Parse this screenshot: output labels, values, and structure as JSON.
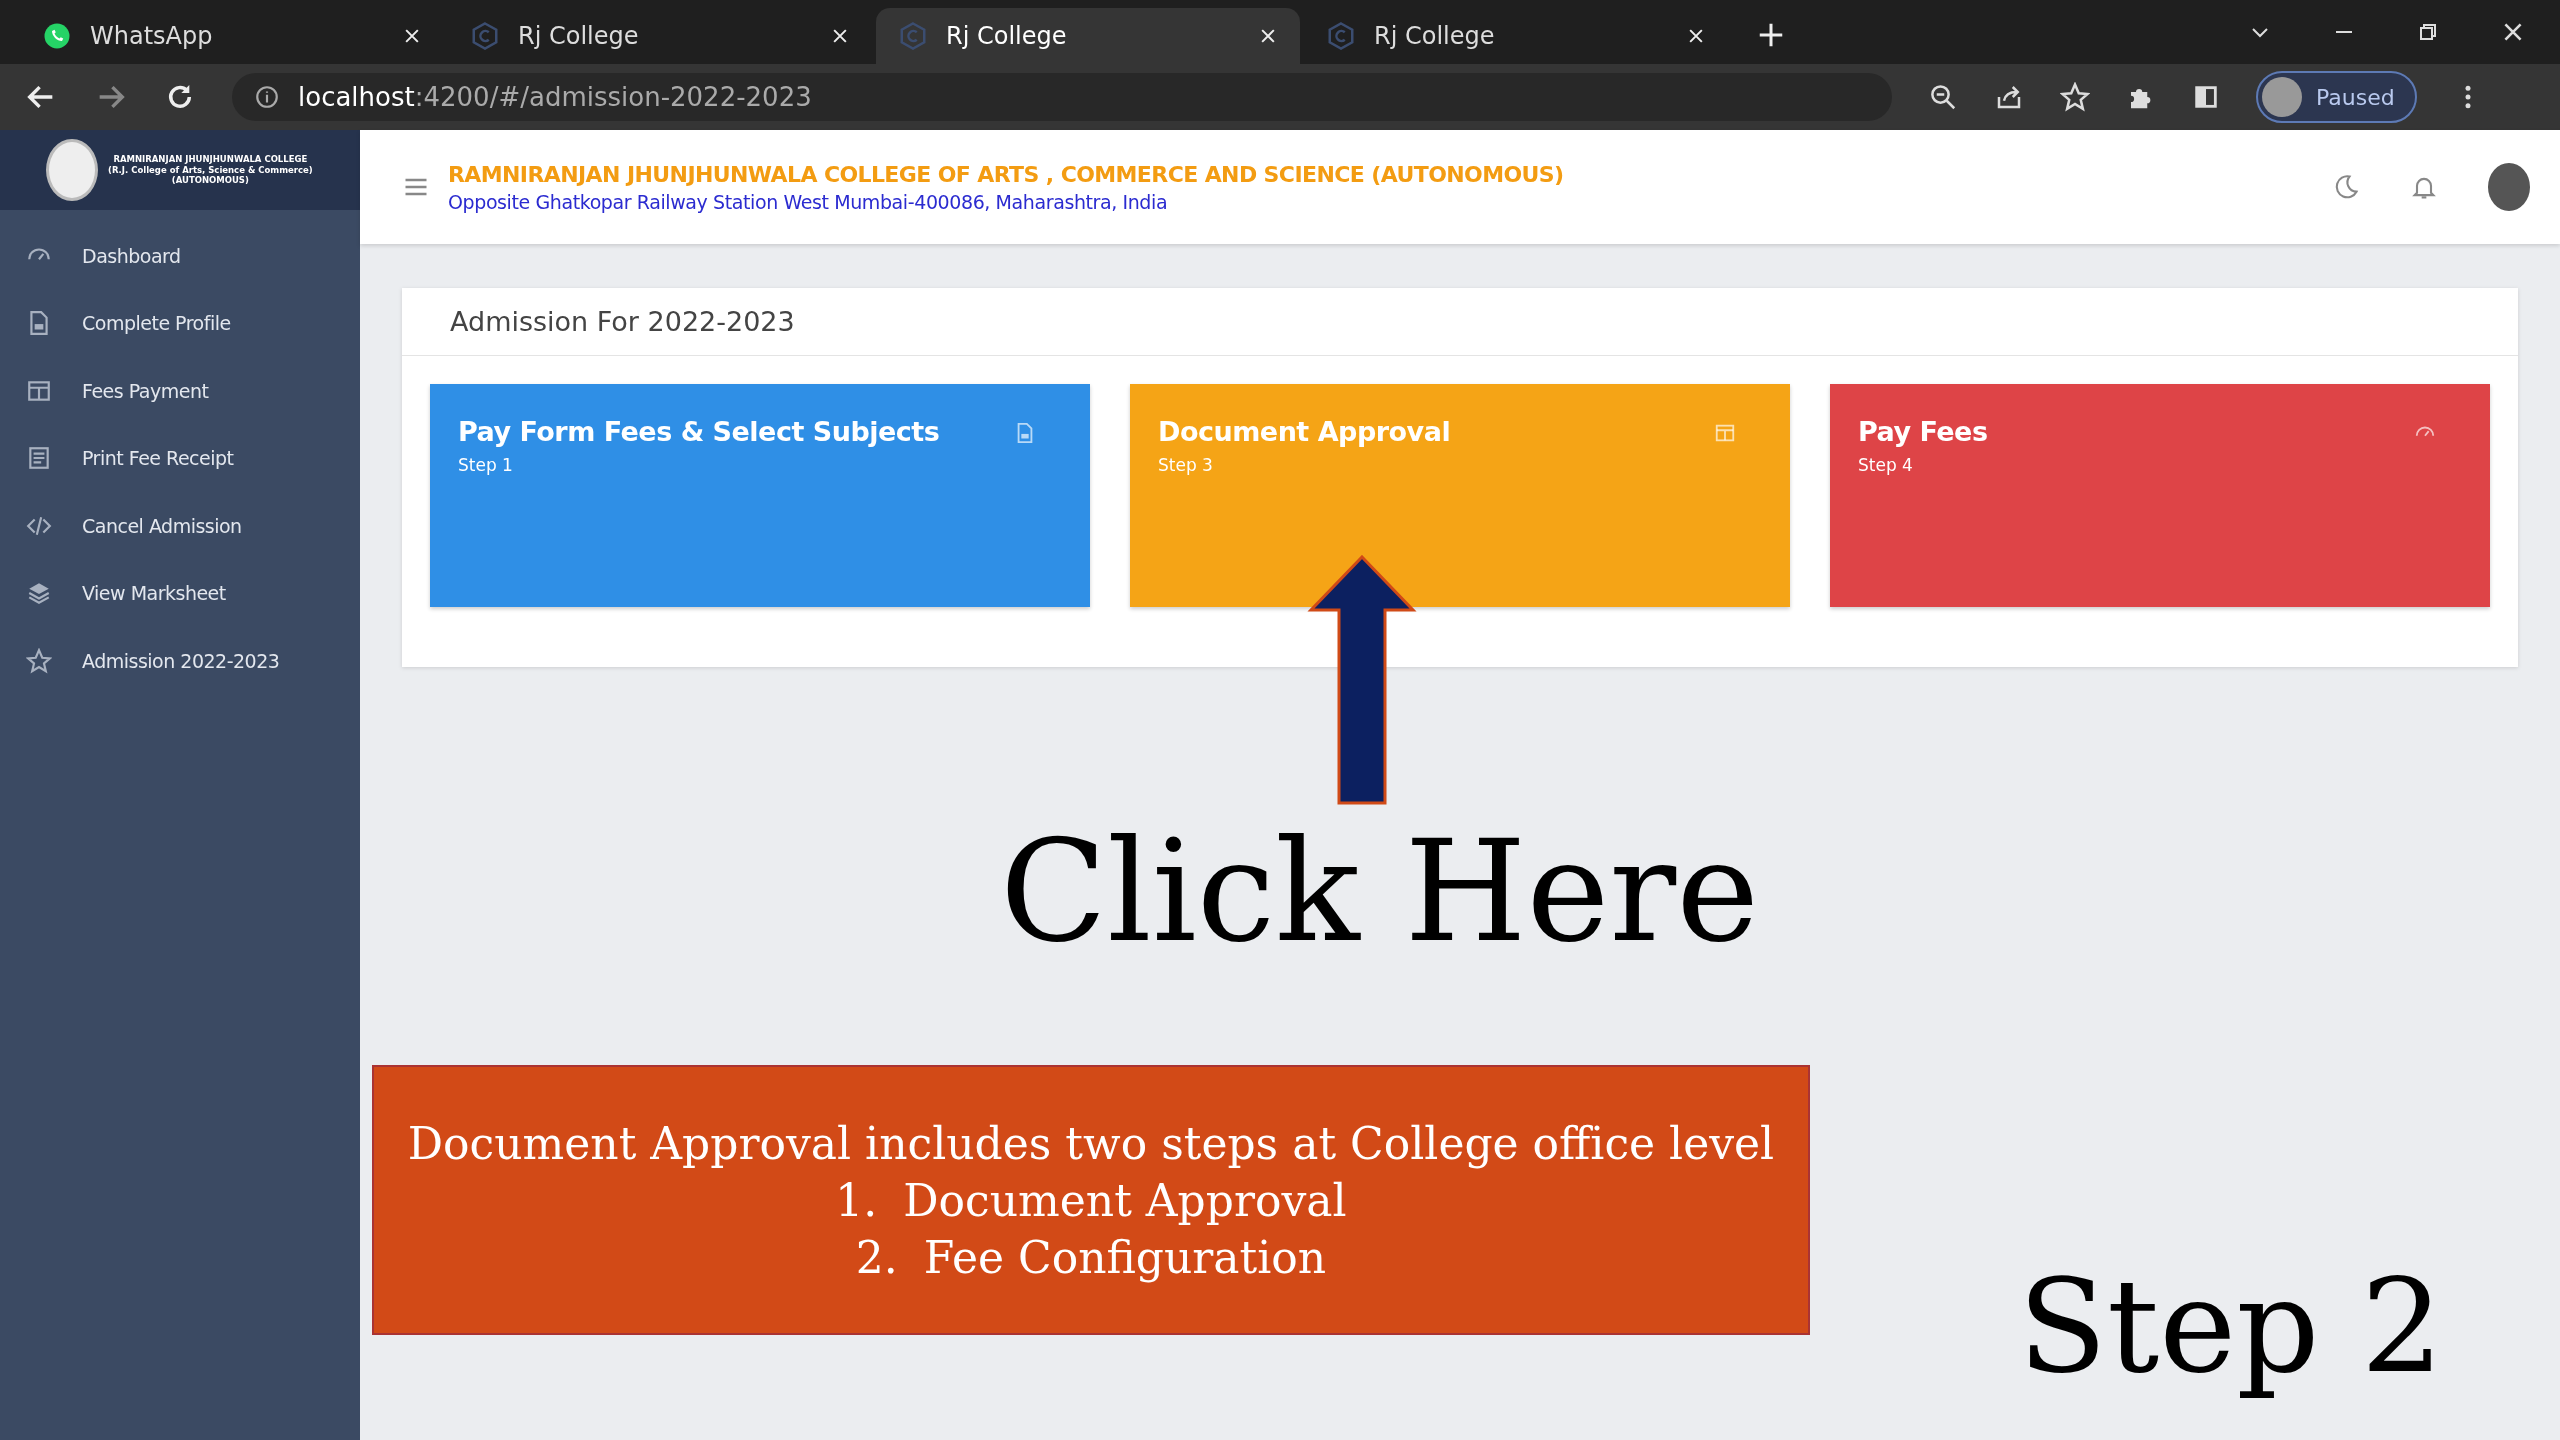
{
  "browser": {
    "tabs": [
      {
        "title": "WhatsApp",
        "kind": "whatsapp",
        "selected": false
      },
      {
        "title": "Rj College",
        "kind": "site",
        "selected": false
      },
      {
        "title": "Rj College",
        "kind": "site",
        "selected": true
      },
      {
        "title": "Rj College",
        "kind": "site",
        "selected": false
      }
    ],
    "address": {
      "host": "localhost",
      "rest": ":4200/#/admission-2022-2023"
    },
    "profile": "Paused"
  },
  "sidebar": {
    "logo_lines": [
      "RAMNIRANJAN JHUNJHUNWALA COLLEGE",
      "(R.J. College of Arts, Science & Commerce)",
      "(AUTONOMOUS)"
    ],
    "items": [
      {
        "label": "Dashboard",
        "kind": "gauge"
      },
      {
        "label": "Complete Profile",
        "kind": "file"
      },
      {
        "label": "Fees Payment",
        "kind": "layout"
      },
      {
        "label": "Print Fee Receipt",
        "kind": "list"
      },
      {
        "label": "Cancel Admission",
        "kind": "code"
      },
      {
        "label": "View Marksheet",
        "kind": "layers"
      },
      {
        "label": "Admission 2022-2023",
        "kind": "star"
      }
    ]
  },
  "header": {
    "title": "RAMNIRANJAN JHUNJHUNWALA COLLEGE OF ARTS , COMMERCE AND SCIENCE (AUTONOMOUS)",
    "subtitle": "Opposite Ghatkopar Railway Station West Mumbai-400086, Maharashtra, India"
  },
  "panel": {
    "title": "Admission For 2022-2023",
    "cards": [
      {
        "title": "Pay Form Fees & Select Subjects",
        "step": "Step 1",
        "color": "#2f8fe6",
        "kind": "file"
      },
      {
        "title": "Document Approval",
        "step": "Step 3",
        "color": "#f5a416",
        "kind": "layout"
      },
      {
        "title": "Pay Fees",
        "step": "Step 4",
        "color": "#de4447",
        "kind": "gauge"
      }
    ]
  },
  "annotations": {
    "click_here": "Click Here",
    "note": {
      "heading": "Document Approval includes two steps at College office level",
      "items": [
        {
          "number": "1.",
          "text": "Document Approval"
        },
        {
          "number": "2.",
          "text": "Fee Configuration"
        }
      ]
    },
    "step_label": "Step 2"
  }
}
